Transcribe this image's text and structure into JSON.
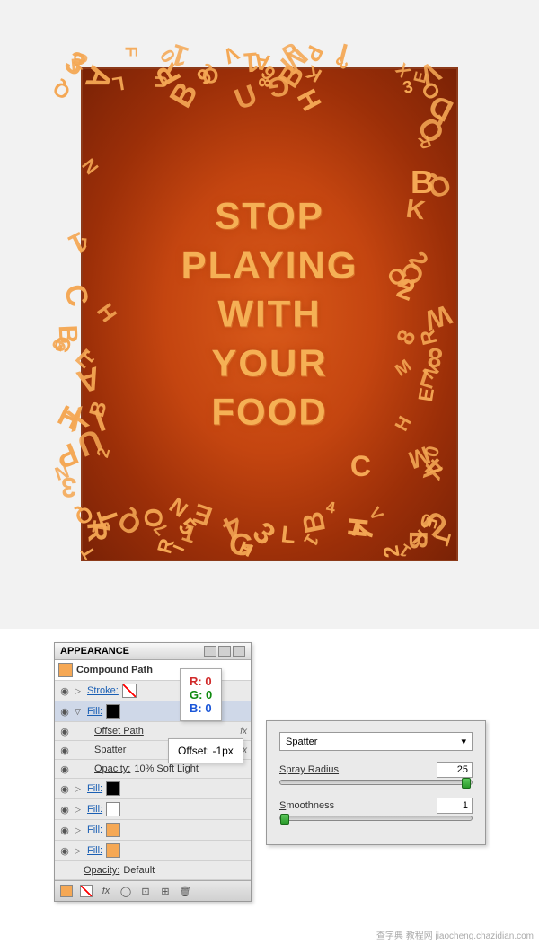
{
  "artwork": {
    "text_lines": [
      "STOP",
      "PLAYING",
      "WITH",
      "YOUR",
      "FOOD"
    ],
    "float_b": "B",
    "float_c": "C",
    "border_colors": {
      "letter": "#f5a855"
    }
  },
  "appearance_panel": {
    "title": "APPEARANCE",
    "compound_path": "Compound Path",
    "stroke_label": "Stroke:",
    "fill_label": "Fill:",
    "offset_path": "Offset Path",
    "spatter": "Spatter",
    "opacity_line": "Opacity:",
    "opacity_val": "10% Soft Light",
    "opacity_default": "Opacity:",
    "default_val": "Default",
    "fx_symbol": "fx"
  },
  "rgb_tooltip": {
    "r": "R: 0",
    "g": "G: 0",
    "b": "B: 0"
  },
  "offset_tooltip": {
    "text": "Offset: -1px"
  },
  "spatter_panel": {
    "dropdown": "Spatter",
    "spray_radius_label": "Spray Radius",
    "spray_radius_value": "25",
    "smoothness_label": "Smoothness",
    "smoothness_value": "1"
  },
  "watermark": "查字典 教程网 jiaocheng.chazidian.com"
}
